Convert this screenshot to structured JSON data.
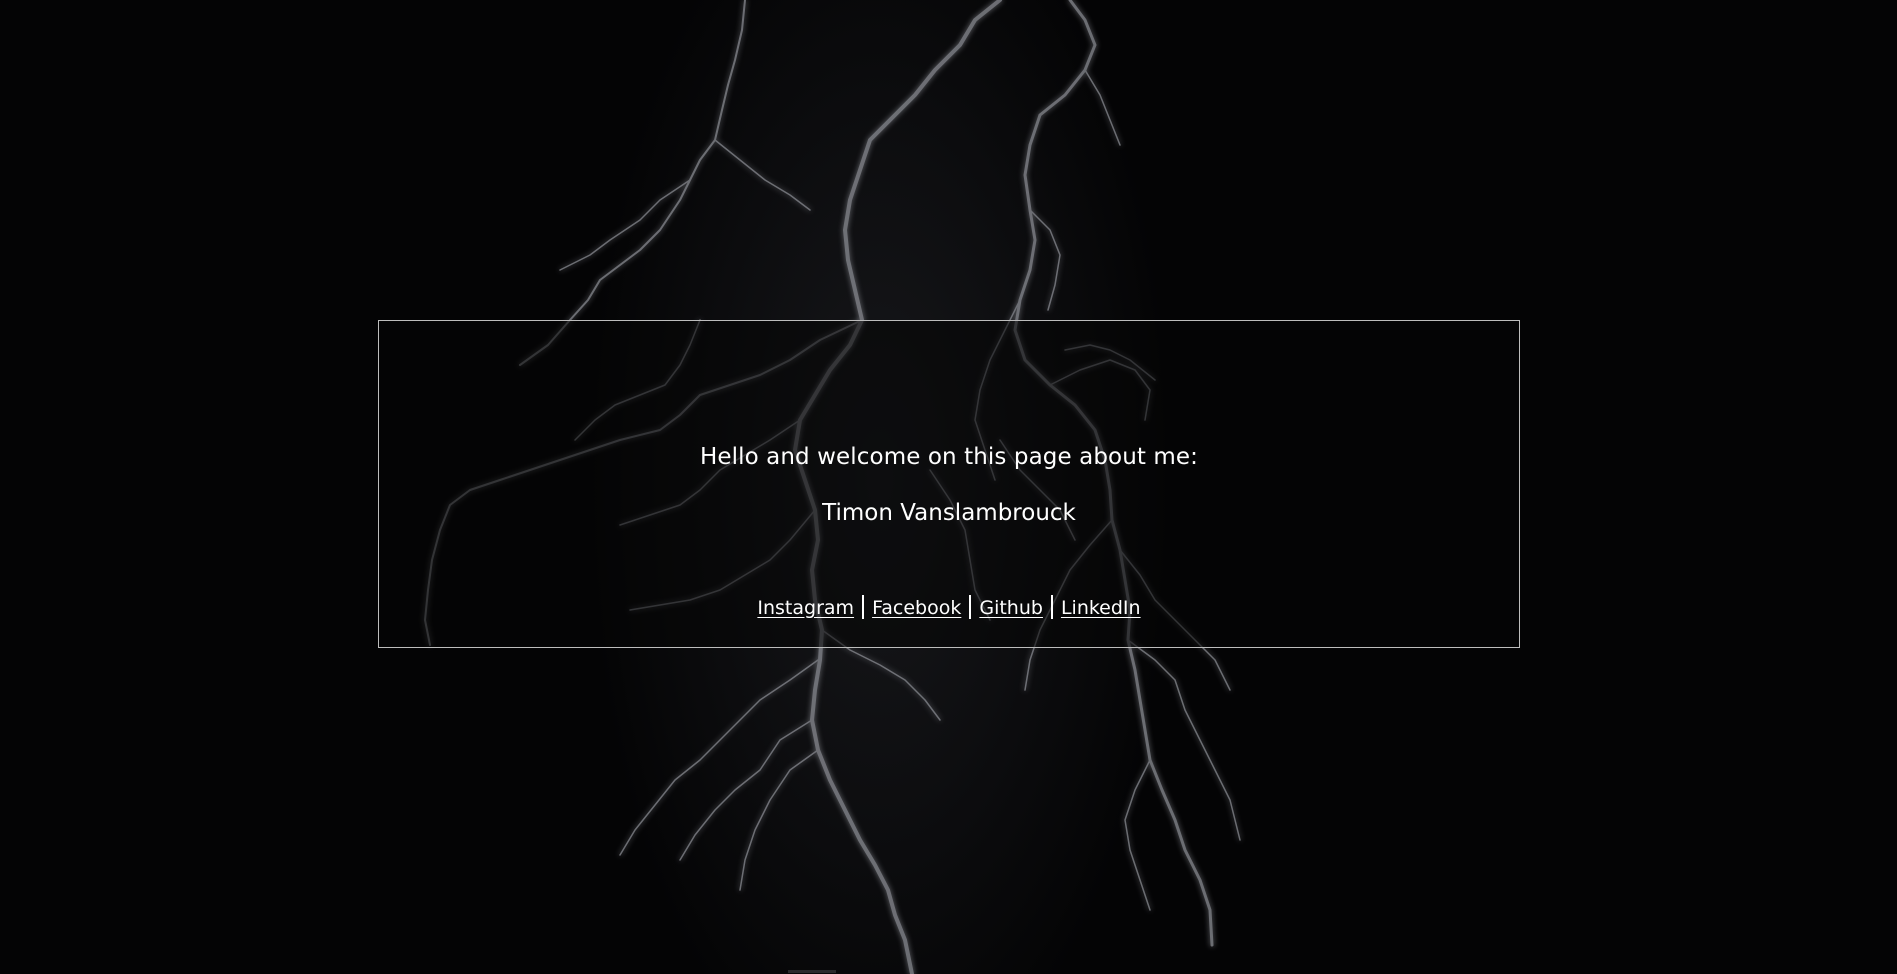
{
  "greeting": "Hello and welcome on this page about me:",
  "name": "Timon Vanslambrouck",
  "links": [
    {
      "label": "Instagram"
    },
    {
      "label": "Facebook"
    },
    {
      "label": "Github"
    },
    {
      "label": "LinkedIn"
    }
  ],
  "colors": {
    "background": "#040405",
    "text": "#ffffff",
    "card_border": "#bdbdbd",
    "lightning": "#9a9ca3"
  },
  "background_image": "lightning-bolt"
}
